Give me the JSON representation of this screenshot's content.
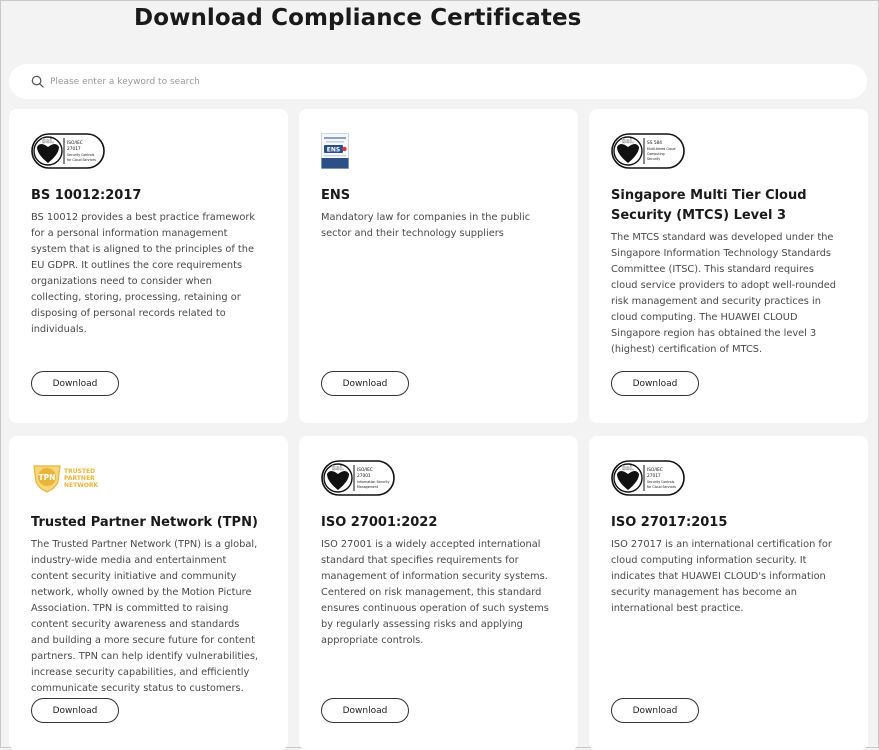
{
  "page": {
    "title": "Download Compliance Certificates"
  },
  "search": {
    "placeholder": "Please enter a keyword to search"
  },
  "cards": [
    {
      "title": "BS 10012:2017",
      "logo": "bsi-iso-27017-icon",
      "desc": "BS 10012 provides a best practice framework for a personal information management system that is aligned to the principles of the EU GDPR. It outlines the core requirements organizations need to consider when collecting, storing, processing, retaining or disposing of personal records related to individuals.",
      "button": "Download"
    },
    {
      "title": "ENS",
      "logo": "ens-certificate-icon",
      "desc": "Mandatory law for companies in the public sector and their technology suppliers",
      "button": "Download"
    },
    {
      "title": "Singapore Multi Tier Cloud Security (MTCS) Level 3",
      "logo": "bsi-ss584-icon",
      "desc": "The MTCS standard was developed under the Singapore Information Technology Standards Committee (ITSC). This standard requires cloud service providers to adopt well-rounded risk management and security practices in cloud computing. The HUAWEI CLOUD Singapore region has obtained the level 3 (highest) certification of MTCS.",
      "button": "Download"
    },
    {
      "title": "Trusted Partner Network (TPN)",
      "logo": "tpn-logo-icon",
      "desc": "The Trusted Partner Network (TPN) is a global, industry-wide media and entertainment content security initiative and community network, wholly owned by the Motion Picture Association. TPN is committed to raising content security awareness and standards and building a more secure future for content partners. TPN can help identify vulnerabilities, increase security capabilities, and efficiently communicate security status to customers.",
      "button": "Download"
    },
    {
      "title": "ISO 27001:2022",
      "logo": "bsi-iso-27001-icon",
      "desc": "ISO 27001 is a widely accepted international standard that specifies requirements for management of information security systems. Centered on risk management, this standard ensures continuous operation of such systems by regularly assessing risks and applying appropriate controls.",
      "button": "Download"
    },
    {
      "title": "ISO 27017:2015",
      "logo": "bsi-iso-27017-icon",
      "desc": "ISO 27017 is an international certification for cloud computing information security. It indicates that HUAWEI CLOUD's information security management has become an international best practice.",
      "button": "Download"
    }
  ],
  "logos": {
    "bsi": "bsi.",
    "iso27017": [
      "ISO/IEC",
      "27017",
      "Security Controls",
      "for Cloud Services"
    ],
    "iso27001": [
      "ISO/IEC",
      "27001",
      "Information Security",
      "Management"
    ],
    "ss584": [
      "SS 584",
      "Multi-tiered Cloud",
      "Computing",
      "Security"
    ],
    "ens": "ENS",
    "tpn_badge": "TPN",
    "tpn_text": [
      "TRUSTED",
      "PARTNER",
      "NETWORK"
    ]
  },
  "colors": {
    "background": "#f3f3f3",
    "card": "#ffffff",
    "tpn_gold": "#e8b53a",
    "ens_blue": "#2b4f86"
  }
}
